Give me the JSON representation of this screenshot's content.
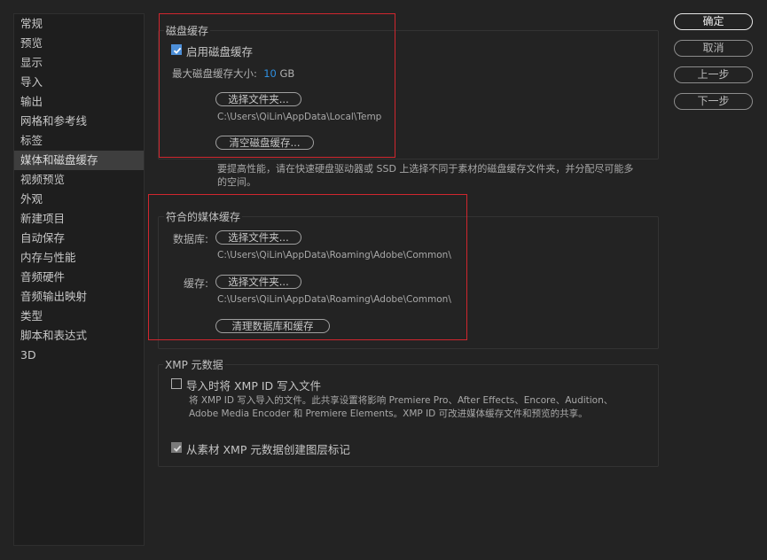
{
  "sidebar": {
    "items": [
      {
        "label": "常规"
      },
      {
        "label": "预览"
      },
      {
        "label": "显示"
      },
      {
        "label": "导入"
      },
      {
        "label": "输出"
      },
      {
        "label": "网格和参考线"
      },
      {
        "label": "标签"
      },
      {
        "label": "媒体和磁盘缓存"
      },
      {
        "label": "视频预览"
      },
      {
        "label": "外观"
      },
      {
        "label": "新建项目"
      },
      {
        "label": "自动保存"
      },
      {
        "label": "内存与性能"
      },
      {
        "label": "音频硬件"
      },
      {
        "label": "音频输出映射"
      },
      {
        "label": "类型"
      },
      {
        "label": "脚本和表达式"
      },
      {
        "label": "3D"
      }
    ],
    "active_index": 7
  },
  "disk_cache": {
    "title": "磁盘缓存",
    "enable_label": "启用磁盘缓存",
    "enabled": true,
    "max_size_label": "最大磁盘缓存大小:",
    "max_size_value": "10",
    "max_size_unit": "GB",
    "choose_folder": "选择文件夹...",
    "folder_path": "C:\\Users\\QiLin\\AppData\\Local\\Temp",
    "clear_button": "清空磁盘缓存...",
    "hint": "要提高性能，请在快速硬盘驱动器或 SSD 上选择不同于素材的磁盘缓存文件夹，并分配尽可能多的空间。"
  },
  "conformed_cache": {
    "title": "符合的媒体缓存",
    "database_label": "数据库:",
    "database_button": "选择文件夹...",
    "database_path": "C:\\Users\\QiLin\\AppData\\Roaming\\Adobe\\Common\\",
    "cache_label": "缓存:",
    "cache_button": "选择文件夹...",
    "cache_path": "C:\\Users\\QiLin\\AppData\\Roaming\\Adobe\\Common\\",
    "clean_button": "清理数据库和缓存"
  },
  "xmp": {
    "title": "XMP 元数据",
    "write_id_label": "导入时将 XMP ID 写入文件",
    "write_id_checked": false,
    "write_id_desc": "将 XMP ID 写入导入的文件。此共享设置将影响 Premiere Pro、After Effects、Encore、Audition、Adobe Media Encoder 和 Premiere Elements。XMP ID 可改进媒体缓存文件和预览的共享。",
    "markers_label": "从素材 XMP 元数据创建图层标记",
    "markers_checked": true
  },
  "dialog_buttons": {
    "ok": "确定",
    "cancel": "取消",
    "prev": "上一步",
    "next": "下一步"
  },
  "colors": {
    "accent": "#2e8fe0",
    "highlight_box": "#d0262e",
    "background": "#232323"
  }
}
